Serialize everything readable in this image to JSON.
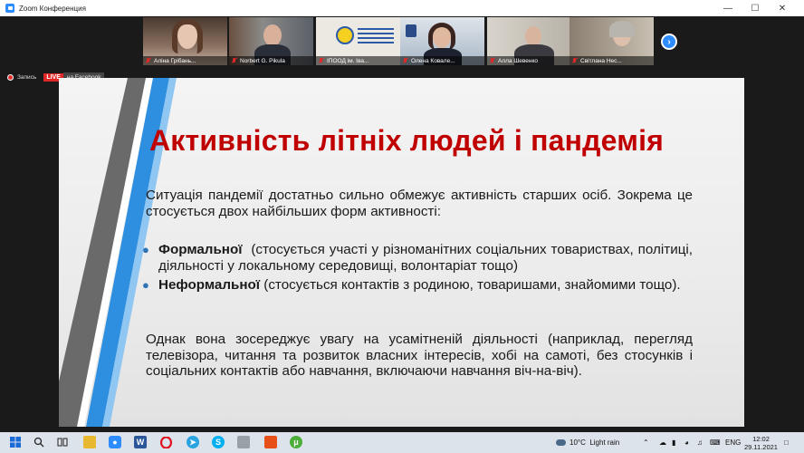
{
  "window": {
    "title": "Zoom Конференция"
  },
  "participants": [
    {
      "name": "Аліна Грібань...",
      "bg": "#6b5a4e"
    },
    {
      "name": "Norbert G. Pikula",
      "bg": "#5a6068"
    },
    {
      "name": "ІПООД ім. Іва...",
      "bg": "#e8e6df"
    },
    {
      "name": "Олена Ковале...",
      "bg": "#7a8898"
    },
    {
      "name": "Алла Шевенко",
      "bg": "#c8c4bc"
    },
    {
      "name": "Світлана Нес...",
      "bg": "#9a9488"
    }
  ],
  "recording": {
    "label": "Запись",
    "live": "LIVE",
    "platform": "на Facebook"
  },
  "slide": {
    "title": "Активність літніх людей і пандемія",
    "intro": "Ситуація пандемії достатньо сильно обмежує активність старших осіб. Зокрема це стосується двох найбільших форм активності:",
    "bullets": [
      {
        "bold": "Формальної",
        "text": "  (стосується участі у різноманітних соціальних товариствах, політиці, діяльності у локальному середовищі, волонтаріат тощо)"
      },
      {
        "bold": "Неформальної",
        "text": " (стосується контактів з родиною, товаришами, знайомими тощо)."
      }
    ],
    "closing": "Однак вона зосереджує увагу на усамітненій діяльності (наприклад, перегляд телевізора, читання та розвиток власних інтересів, хобі на самоті, без стосунків і соціальних контактів або навчання, включаючи навчання віч-на-віч)."
  },
  "taskbar": {
    "weather": "10°C  Light rain",
    "language": "ENG",
    "time": "12:02",
    "date": "29.11.2021"
  },
  "colors": {
    "accent_blue": "#2d8cff",
    "title_red": "#c00000",
    "stripe_blue": "#2e8fe0",
    "stripe_gray": "#6a6a6a"
  }
}
